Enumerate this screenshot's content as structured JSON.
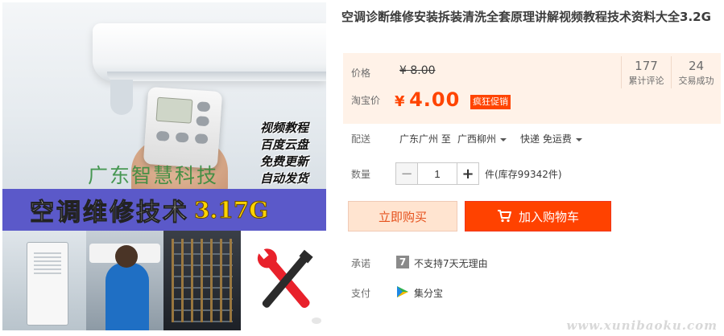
{
  "product": {
    "title": "空调诊断维修安装拆装清洗全套原理讲解视频教程技术资料大全3.2G",
    "image": {
      "tag_lines": [
        "视频教程",
        "百度云盘",
        "免费更新",
        "自动发货"
      ],
      "watermark_text": "广东智慧科技",
      "banner_title": "空调维修技术",
      "banner_size": "3.17G"
    }
  },
  "price": {
    "price_label": "价格",
    "original_price": "¥ 8.00",
    "taobao_label": "淘宝价",
    "currency": "¥",
    "current_price": "4.00",
    "promo_tag": "疯狂促销",
    "accent_color": "#ff4400",
    "background_color": "#fff2e8"
  },
  "stats": [
    {
      "value": "177",
      "label": "累计评论"
    },
    {
      "value": "24",
      "label": "交易成功"
    }
  ],
  "shipping": {
    "label": "配送",
    "from": "广东广州 至",
    "to": "广西柳州",
    "method": "快递 免运费"
  },
  "quantity": {
    "label": "数量",
    "minus": "−",
    "value": "1",
    "plus": "+",
    "stock_text": "件(库存99342件)"
  },
  "actions": {
    "buy_now": "立即购买",
    "add_to_cart": "加入购物车"
  },
  "promise": {
    "label": "承诺",
    "badge": "7",
    "text": "不支持7天无理由"
  },
  "payment": {
    "label": "支付",
    "method": "集分宝"
  },
  "site_watermark": "www.xunibaoku.com"
}
